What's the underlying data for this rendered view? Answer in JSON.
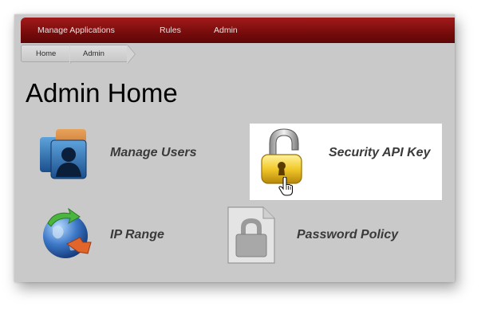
{
  "nav": {
    "items": [
      {
        "label": "Manage Applications",
        "icon": "none"
      },
      {
        "label": "Rules",
        "icon": "none"
      },
      {
        "label": "Admin",
        "icon": "none"
      }
    ]
  },
  "breadcrumb": {
    "items": [
      "Home",
      "Admin"
    ]
  },
  "page": {
    "title": "Admin Home"
  },
  "tiles": [
    {
      "label": "Manage Users",
      "icon": "users-icon"
    },
    {
      "label": "Security API Key",
      "icon": "padlock-icon",
      "highlighted": true
    },
    {
      "label": "IP Range",
      "icon": "globe-arrow-icon"
    },
    {
      "label": "Password Policy",
      "icon": "password-lock-icon"
    }
  ],
  "colors": {
    "navbar": "#7a0d0d",
    "background": "#c9c9c9",
    "highlight": "#ffffff"
  }
}
